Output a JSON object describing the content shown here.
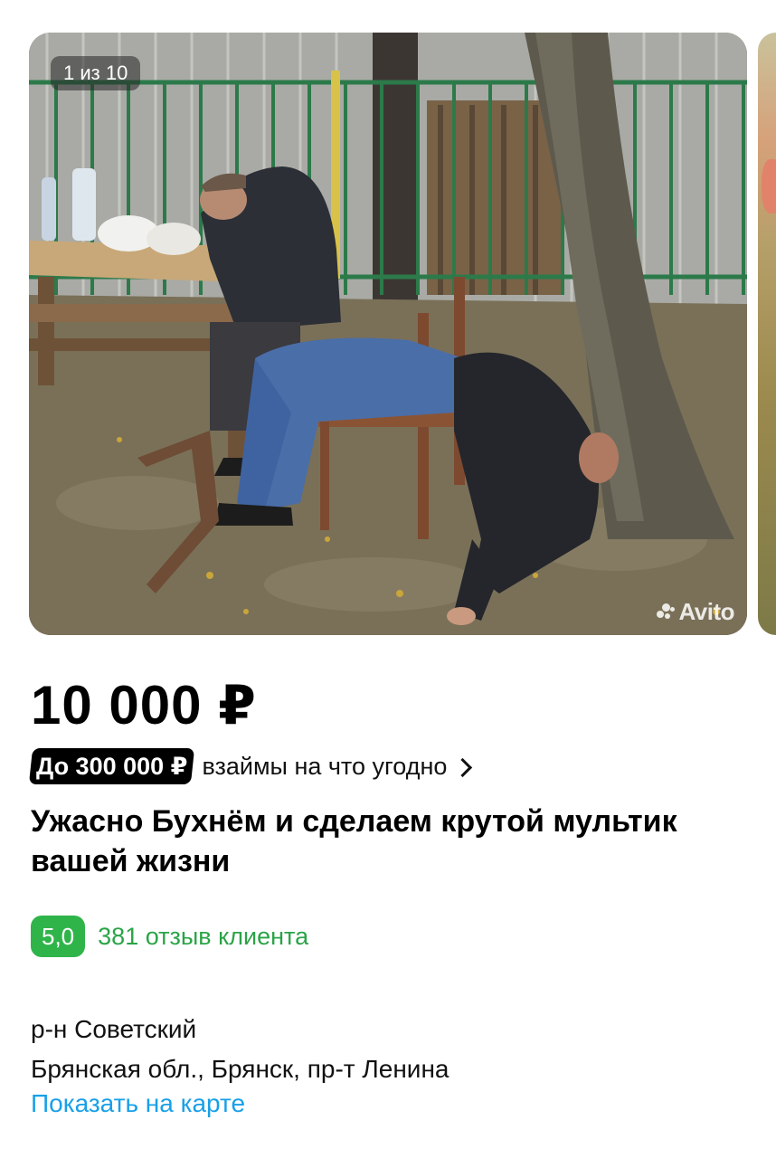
{
  "gallery": {
    "counter": "1 из 10",
    "watermark": "Avito"
  },
  "listing": {
    "price": "10 000 ₽",
    "loan_badge": "До 300 000 ₽",
    "loan_text": "взаймы на что угодно",
    "title": "Ужасно Бухнём и сделаем крутой мультик вашей жизни",
    "rating": "5,0",
    "reviews": "381 отзыв клиента"
  },
  "location": {
    "district": "р-н Советский",
    "address": "Брянская обл., Брянск, пр-т Ленина",
    "map_link": "Показать на карте"
  },
  "colors": {
    "rating_badge": "#2fb44a",
    "reviews_link": "#2aa447",
    "map_link": "#18a0e8"
  }
}
